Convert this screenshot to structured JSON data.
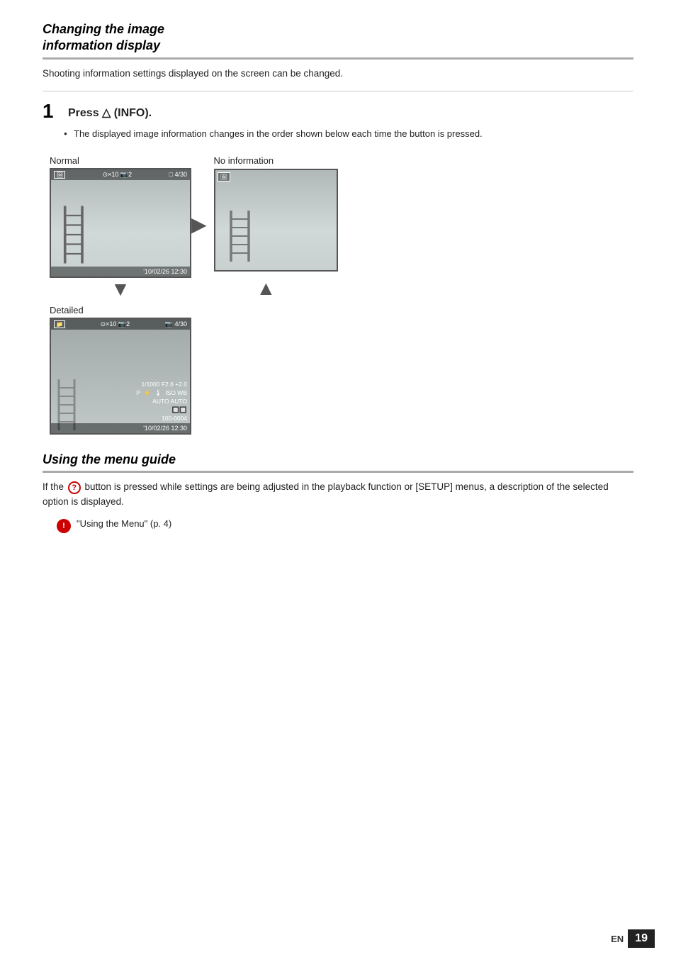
{
  "section1": {
    "heading_line1": "Changing the image",
    "heading_line2": "information display",
    "intro": "Shooting information settings displayed on the screen can be changed.",
    "step_number": "1",
    "step_title_prefix": "Press ",
    "step_triangle": "△",
    "step_title_suffix": " (INFO).",
    "bullet": "The displayed image information changes in the order shown below each time the button is pressed.",
    "label_normal": "Normal",
    "label_detailed": "Detailed",
    "label_no_information": "No information",
    "normal_top_left_icon": "🔲",
    "normal_top_center": "⊙×10 📷2",
    "normal_top_right": "□ 4/30",
    "normal_bottom": "'10/02/26 12:30",
    "detailed_top_left": "📁",
    "detailed_top_center": "⊙×10 📷2",
    "detailed_top_right": "📷 4/30",
    "detailed_shutter": "1/1000  F2.6  +2.0",
    "detailed_mode": "P  ⚡  🌡  ISO WB",
    "detailed_mode2": "AUTO AUTO",
    "detailed_icons": "🔲🔲",
    "detailed_frame": "100-0004",
    "detailed_date": "'10/02/26  12:30",
    "no_info_icon": "🔲"
  },
  "section2": {
    "heading": "Using the menu guide",
    "body1": "If the ",
    "body_icon": "?",
    "body2": " button is pressed while settings are being adjusted in the playback function or [SETUP] menus, a description of the selected option is displayed.",
    "note_text": "\"Using the Menu\" (p. 4)"
  },
  "footer": {
    "en_label": "EN",
    "page_number": "19"
  }
}
